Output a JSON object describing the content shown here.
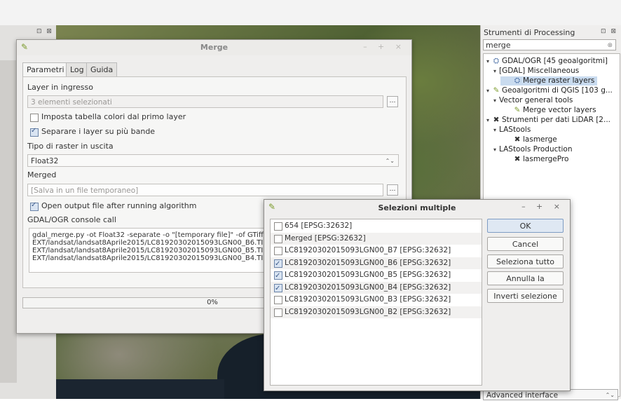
{
  "processing_panel": {
    "title": "Strumenti di Processing",
    "window_buttons": "⊡ ⊠",
    "search_value": "merge",
    "tree": [
      {
        "label": "GDAL/OGR [45 geoalgoritmi]",
        "icon": "gdal-icon",
        "level": 0
      },
      {
        "label": "[GDAL] Miscellaneous",
        "icon": "",
        "level": 1
      },
      {
        "label": "Merge raster layers",
        "icon": "gdal-icon",
        "level": 2,
        "selected": true
      },
      {
        "label": "Geoalgoritmi di QGIS [103 g...",
        "icon": "qgis-icon",
        "level": 0
      },
      {
        "label": "Vector general tools",
        "icon": "",
        "level": 1
      },
      {
        "label": "Merge vector layers",
        "icon": "qgis-icon",
        "level": 2
      },
      {
        "label": "Strumenti per dati LiDAR [2...",
        "icon": "lidar-icon",
        "level": 0
      },
      {
        "label": "LAStools",
        "icon": "",
        "level": 1
      },
      {
        "label": "lasmerge",
        "icon": "lidar-icon",
        "level": 2
      },
      {
        "label": "LAStools Production",
        "icon": "",
        "level": 1
      },
      {
        "label": "lasmergePro",
        "icon": "lidar-icon",
        "level": 2
      }
    ],
    "interface_select": "Advanced interface"
  },
  "merge_dialog": {
    "title": "Merge",
    "controls": "– + ×",
    "tabs": [
      "Parametri",
      "Log",
      "Guida"
    ],
    "input_layers_label": "Layer in ingresso",
    "input_layers_value": "3 elementi selezionati",
    "color_table_label": "Imposta tabella colori dal primo layer",
    "separate_label": "Separare i layer su più bande",
    "raster_type_label": "Tipo di raster in uscita",
    "raster_type_value": "Float32",
    "merged_label": "Merged",
    "merged_placeholder": "[Salva in un file temporaneo]",
    "open_output_label": "Open output file after running algorithm",
    "console_label": "GDAL/OGR console call",
    "console_lines": [
      "gdal_merge.py -ot Float32 -separate -o \"[temporary file]\" -of GTiff",
      "EXT/landsat/landsat8Aprile2015/LC81920302015093LGN00_B6.TIF",
      "EXT/landsat/landsat8Aprile2015/LC81920302015093LGN00_B5.TIF",
      "EXT/landsat/landsat8Aprile2015/LC81920302015093LGN00_B4.TIF"
    ],
    "progress_text": "0%",
    "progress_fraction": 0.0
  },
  "multi_select_dialog": {
    "title": "Selezioni multiple",
    "controls": "– + ×",
    "items": [
      {
        "label": "654 [EPSG:32632]",
        "checked": false
      },
      {
        "label": "Merged [EPSG:32632]",
        "checked": false
      },
      {
        "label": "LC81920302015093LGN00_B7 [EPSG:32632]",
        "checked": false
      },
      {
        "label": "LC81920302015093LGN00_B6 [EPSG:32632]",
        "checked": true
      },
      {
        "label": "LC81920302015093LGN00_B5 [EPSG:32632]",
        "checked": true
      },
      {
        "label": "LC81920302015093LGN00_B4 [EPSG:32632]",
        "checked": true
      },
      {
        "label": "LC81920302015093LGN00_B3 [EPSG:32632]",
        "checked": false
      },
      {
        "label": "LC81920302015093LGN00_B2 [EPSG:32632]",
        "checked": false
      }
    ],
    "buttons": {
      "ok": "OK",
      "cancel": "Cancel",
      "select_all": "Seleziona tutto",
      "clear": "Annulla la selezione",
      "invert": "Inverti selezione"
    }
  },
  "left_dock": {
    "buttons": "⊡ ⊠"
  }
}
